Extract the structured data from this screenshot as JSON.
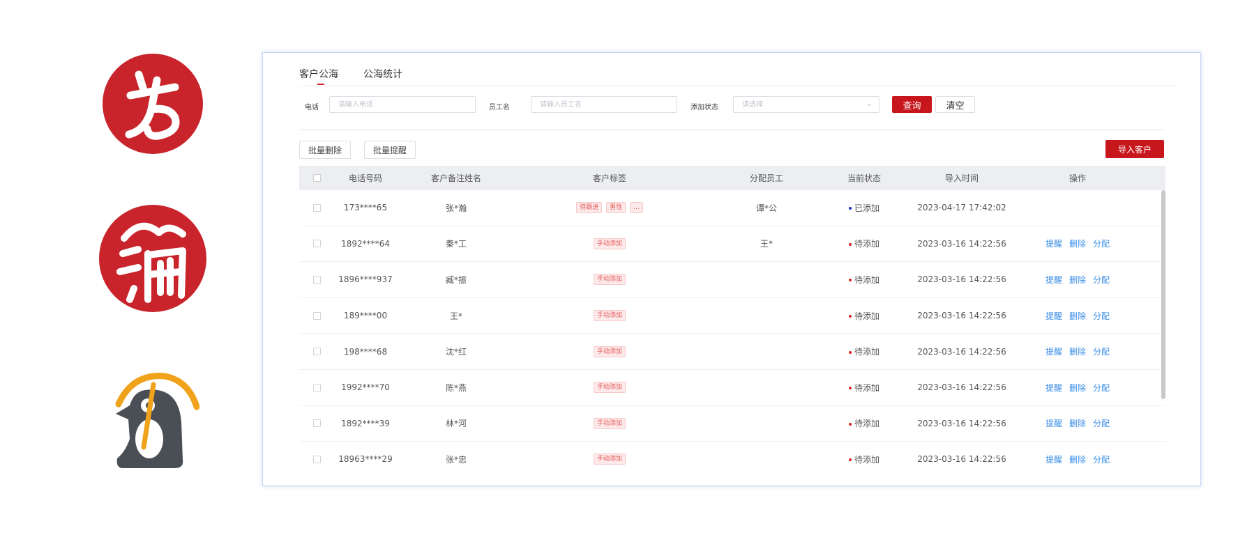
{
  "colors": {
    "accent": "#c8161d",
    "link": "#3a8ee6",
    "added_dot": "#1b2fd0",
    "pending_dot": "#e02020"
  },
  "logos": [
    "red-circle-calligraphy-logo",
    "red-circle-ride-logo",
    "penguin-logo"
  ],
  "tabs": [
    {
      "label": "客户公海",
      "active": true
    },
    {
      "label": "公海统计",
      "active": false
    }
  ],
  "filters": {
    "phone_label": "电话",
    "phone_placeholder": "请输入电话",
    "employee_label": "员工名",
    "employee_placeholder": "请输入员工名",
    "status_label": "添加状态",
    "status_placeholder": "请选择",
    "query_label": "查询",
    "clear_label": "清空"
  },
  "toolbar": {
    "batch_delete": "批量删除",
    "batch_remind": "批量提醒",
    "import": "导入客户"
  },
  "table": {
    "headers": [
      "电话号码",
      "客户备注姓名",
      "客户标签",
      "分配员工",
      "当前状态",
      "导入时间",
      "操作"
    ],
    "ops": [
      "提醒",
      "删除",
      "分配"
    ],
    "rows": [
      {
        "phone": "173****65",
        "name": "张*瀚",
        "tags": [
          "待跟进",
          "男性",
          "..."
        ],
        "employee": "谭*公",
        "status": "已添加",
        "status_color": "#1b2fd0",
        "time": "2023-04-17 17:42:02",
        "has_ops": false
      },
      {
        "phone": "1892****64",
        "name": "秦*工",
        "tags": [
          "手动添加"
        ],
        "employee": "王*",
        "status": "待添加",
        "status_color": "#e02020",
        "time": "2023-03-16 14:22:56",
        "has_ops": true
      },
      {
        "phone": "1896****937",
        "name": "臧*振",
        "tags": [
          "手动添加"
        ],
        "employee": "",
        "status": "待添加",
        "status_color": "#e02020",
        "time": "2023-03-16 14:22:56",
        "has_ops": true
      },
      {
        "phone": "189****00",
        "name": "王*",
        "tags": [
          "手动添加"
        ],
        "employee": "",
        "status": "待添加",
        "status_color": "#e02020",
        "time": "2023-03-16 14:22:56",
        "has_ops": true
      },
      {
        "phone": "198****68",
        "name": "沈*红",
        "tags": [
          "手动添加"
        ],
        "employee": "",
        "status": "待添加",
        "status_color": "#e02020",
        "time": "2023-03-16 14:22:56",
        "has_ops": true
      },
      {
        "phone": "1992****70",
        "name": "陈*燕",
        "tags": [
          "手动添加"
        ],
        "employee": "",
        "status": "待添加",
        "status_color": "#e02020",
        "time": "2023-03-16 14:22:56",
        "has_ops": true
      },
      {
        "phone": "1892****39",
        "name": "林*河",
        "tags": [
          "手动添加"
        ],
        "employee": "",
        "status": "待添加",
        "status_color": "#e02020",
        "time": "2023-03-16 14:22:56",
        "has_ops": true
      },
      {
        "phone": "18963****29",
        "name": "张*忠",
        "tags": [
          "手动添加"
        ],
        "employee": "",
        "status": "待添加",
        "status_color": "#e02020",
        "time": "2023-03-16 14:22:56",
        "has_ops": true
      }
    ]
  }
}
